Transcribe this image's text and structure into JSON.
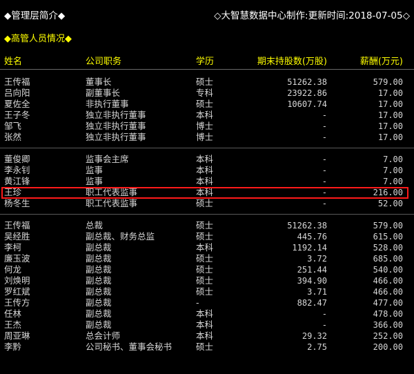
{
  "header": {
    "title": "◆管理层简介◆",
    "right_info": "◇大智慧数据中心制作:更新时间:2018-07-05◇"
  },
  "section": {
    "title": "◆高管人员情况◆"
  },
  "columns": {
    "name": "姓名",
    "position": "公司职务",
    "education": "学历",
    "shares": "期末持股数(万股)",
    "salary": "薪酬(万元)"
  },
  "groups": [
    {
      "rows": [
        {
          "name": "王传福",
          "position": "董事长",
          "education": "硕士",
          "shares": "51262.38",
          "salary": "579.00"
        },
        {
          "name": "吕向阳",
          "position": "副董事长",
          "education": "专科",
          "shares": "23922.86",
          "salary": "17.00"
        },
        {
          "name": "夏佐全",
          "position": "非执行董事",
          "education": "硕士",
          "shares": "10607.74",
          "salary": "17.00"
        },
        {
          "name": "王子冬",
          "position": "独立非执行董事",
          "education": "本科",
          "shares": "-",
          "salary": "17.00"
        },
        {
          "name": "邹飞",
          "position": "独立非执行董事",
          "education": "博士",
          "shares": "-",
          "salary": "17.00"
        },
        {
          "name": "张然",
          "position": "独立非执行董事",
          "education": "博士",
          "shares": "-",
          "salary": "17.00"
        }
      ]
    },
    {
      "rows": [
        {
          "name": "董俊卿",
          "position": "监事会主席",
          "education": "本科",
          "shares": "-",
          "salary": "7.00"
        },
        {
          "name": "李永钊",
          "position": "监事",
          "education": "本科",
          "shares": "-",
          "salary": "7.00"
        },
        {
          "name": "黄江锋",
          "position": "监事",
          "education": "本科",
          "shares": "-",
          "salary": "7.00"
        },
        {
          "name": "王珍",
          "position": "职工代表监事",
          "education": "本科",
          "shares": "-",
          "salary": "216.00",
          "highlighted": true
        },
        {
          "name": "杨冬生",
          "position": "职工代表监事",
          "education": "硕士",
          "shares": "-",
          "salary": "52.00"
        }
      ]
    },
    {
      "rows": [
        {
          "name": "王传福",
          "position": "总裁",
          "education": "硕士",
          "shares": "51262.38",
          "salary": "579.00"
        },
        {
          "name": "吴经胜",
          "position": "副总裁、财务总监",
          "education": "硕士",
          "shares": "445.76",
          "salary": "615.00"
        },
        {
          "name": "李柯",
          "position": "副总裁",
          "education": "本科",
          "shares": "1192.14",
          "salary": "528.00"
        },
        {
          "name": "廉玉波",
          "position": "副总裁",
          "education": "硕士",
          "shares": "3.72",
          "salary": "685.00"
        },
        {
          "name": "何龙",
          "position": "副总裁",
          "education": "硕士",
          "shares": "251.44",
          "salary": "540.00"
        },
        {
          "name": "刘焕明",
          "position": "副总裁",
          "education": "硕士",
          "shares": "394.90",
          "salary": "466.00"
        },
        {
          "name": "罗红斌",
          "position": "副总裁",
          "education": "硕士",
          "shares": "3.71",
          "salary": "466.00"
        },
        {
          "name": "王传方",
          "position": "副总裁",
          "education": "-",
          "shares": "882.47",
          "salary": "477.00"
        },
        {
          "name": "任林",
          "position": "副总裁",
          "education": "本科",
          "shares": "-",
          "salary": "478.00"
        },
        {
          "name": "王杰",
          "position": "副总裁",
          "education": "本科",
          "shares": "-",
          "salary": "366.00"
        },
        {
          "name": "周亚琳",
          "position": "总会计师",
          "education": "本科",
          "shares": "29.32",
          "salary": "252.00"
        },
        {
          "name": "李黔",
          "position": "公司秘书、董事会秘书",
          "education": "硕士",
          "shares": "2.75",
          "salary": "200.00"
        }
      ]
    }
  ]
}
